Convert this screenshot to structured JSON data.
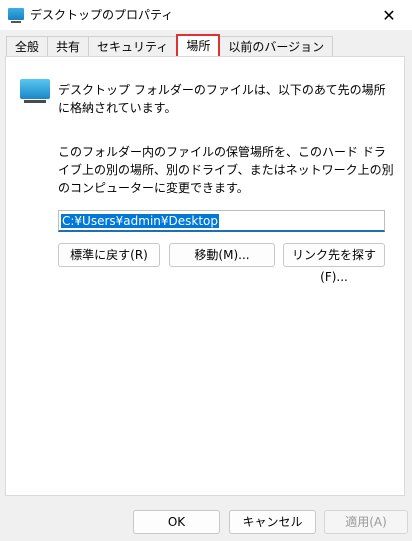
{
  "window": {
    "title": "デスクトップのプロパティ",
    "close_glyph": "✕"
  },
  "tabs": [
    {
      "label": "全般"
    },
    {
      "label": "共有"
    },
    {
      "label": "セキュリティ"
    },
    {
      "label": "場所",
      "active": true
    },
    {
      "label": "以前のバージョン"
    }
  ],
  "location": {
    "description": "デスクトップ フォルダーのファイルは、以下のあて先の場所に格納されています。",
    "instructions": "このフォルダー内のファイルの保管場所を、このハード ドライブ上の別の場所、別のドライブ、またはネットワーク上の別のコンピューターに変更できます。",
    "path_value": "C:¥Users¥admin¥Desktop",
    "restore_button": "標準に戻す(R)",
    "move_button": "移動(M)...",
    "find_target_button": "リンク先を探す(F)..."
  },
  "footer": {
    "ok": "OK",
    "cancel": "キャンセル",
    "apply": "適用(A)"
  },
  "colors": {
    "selection": "#0078d7",
    "active_tab_highlight": "#e03030"
  }
}
